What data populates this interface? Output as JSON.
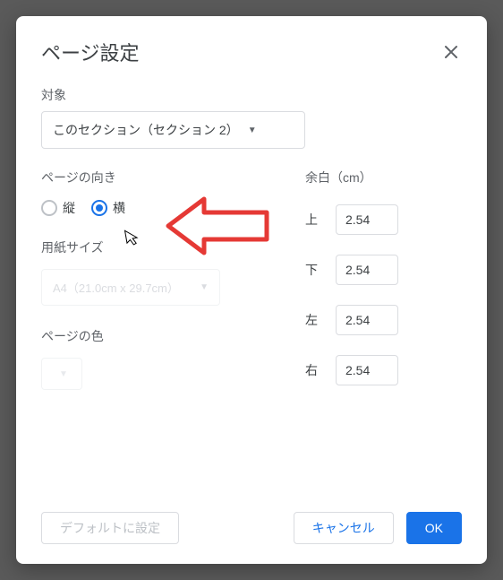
{
  "dialog": {
    "title": "ページ設定",
    "apply_to_label": "対象",
    "apply_to_value": "このセクション（セクション 2）",
    "orientation_label": "ページの向き",
    "orientation": {
      "portrait": "縦",
      "landscape": "横",
      "selected": "landscape"
    },
    "paper_size_label": "用紙サイズ",
    "paper_size_value": "A4（21.0cm x 29.7cm）",
    "page_color_label": "ページの色",
    "margins_label": "余白（cm）",
    "margins": {
      "top_label": "上",
      "top": "2.54",
      "bottom_label": "下",
      "bottom": "2.54",
      "left_label": "左",
      "left": "2.54",
      "right_label": "右",
      "right": "2.54"
    },
    "buttons": {
      "set_default": "デフォルトに設定",
      "cancel": "キャンセル",
      "ok": "OK"
    }
  }
}
